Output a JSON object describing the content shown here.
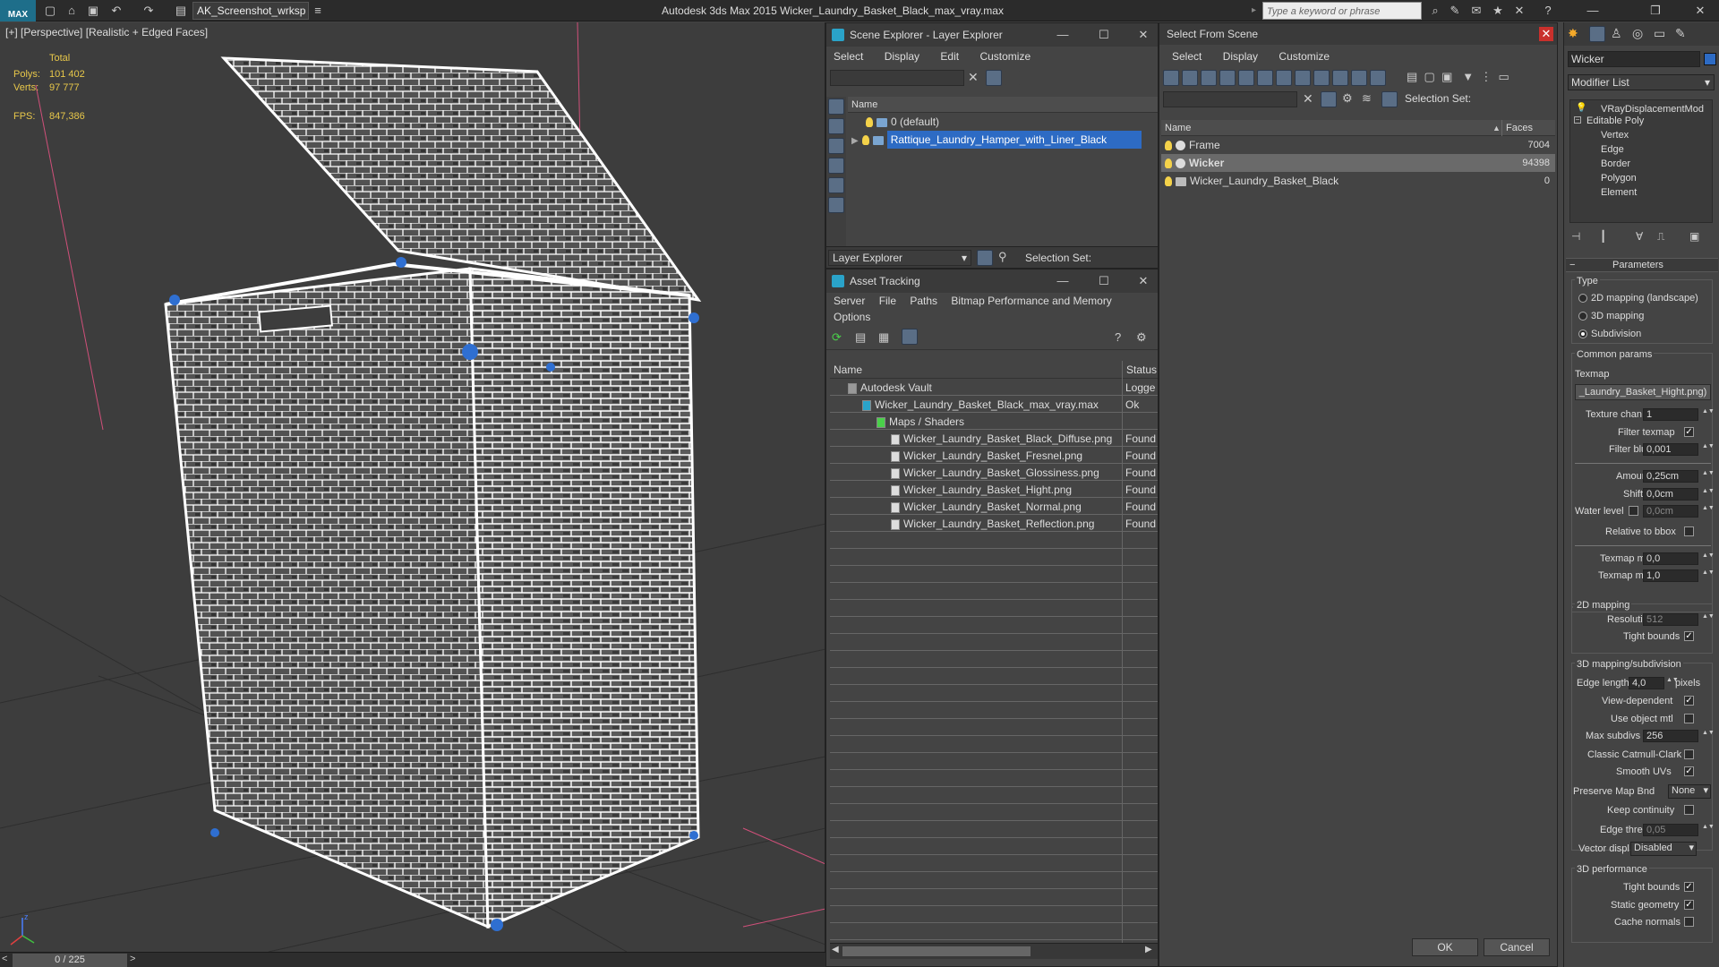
{
  "titlebar": {
    "workspace": "AK_Screenshot_wrksp",
    "title": "Autodesk 3ds Max  2015    Wicker_Laundry_Basket_Black_max_vray.max",
    "search_placeholder": "Type a keyword or phrase",
    "logo": "MAX"
  },
  "viewport": {
    "label": "[+] [Perspective] [Realistic + Edged Faces]",
    "stats": {
      "total_label": "Total",
      "polys_label": "Polys:",
      "polys_value": "101 402",
      "verts_label": "Verts:",
      "verts_value": "97 777",
      "fps_label": "FPS:",
      "fps_value": "847,386"
    },
    "time_slider": "0 / 225",
    "prev": "<",
    "next": ">"
  },
  "layer_explorer": {
    "title": "Scene Explorer - Layer Explorer",
    "menu": [
      "Select",
      "Display",
      "Edit",
      "Customize"
    ],
    "column_name": "Name",
    "rows": [
      {
        "name": "0 (default)",
        "selected": false
      },
      {
        "name": "Rattique_Laundry_Hamper_with_Liner_Black",
        "selected": true
      }
    ],
    "footer_dropdown": "Layer Explorer",
    "selection_set_label": "Selection Set:"
  },
  "asset_tracking": {
    "title": "Asset Tracking",
    "menu": [
      "Server",
      "File",
      "Paths",
      "Bitmap Performance and Memory"
    ],
    "menu2": "Options",
    "col_name": "Name",
    "col_status": "Status",
    "rows": [
      {
        "name": "Autodesk Vault",
        "status": "Logge",
        "indent": 0
      },
      {
        "name": "Wicker_Laundry_Basket_Black_max_vray.max",
        "status": "Ok",
        "indent": 1
      },
      {
        "name": "Maps / Shaders",
        "status": "",
        "indent": 2
      },
      {
        "name": "Wicker_Laundry_Basket_Black_Diffuse.png",
        "status": "Found",
        "indent": 3
      },
      {
        "name": "Wicker_Laundry_Basket_Fresnel.png",
        "status": "Found",
        "indent": 3
      },
      {
        "name": "Wicker_Laundry_Basket_Glossiness.png",
        "status": "Found",
        "indent": 3
      },
      {
        "name": "Wicker_Laundry_Basket_Hight.png",
        "status": "Found",
        "indent": 3
      },
      {
        "name": "Wicker_Laundry_Basket_Normal.png",
        "status": "Found",
        "indent": 3
      },
      {
        "name": "Wicker_Laundry_Basket_Reflection.png",
        "status": "Found",
        "indent": 3
      }
    ]
  },
  "select_from_scene": {
    "title": "Select From Scene",
    "menu": [
      "Select",
      "Display",
      "Customize"
    ],
    "selection_set_label": "Selection Set:",
    "col_name": "Name",
    "col_faces": "Faces",
    "rows": [
      {
        "name": "Frame",
        "faces": "7004",
        "selected": false
      },
      {
        "name": "Wicker",
        "faces": "94398",
        "selected": true
      },
      {
        "name": "Wicker_Laundry_Basket_Black",
        "faces": "0",
        "selected": false
      }
    ],
    "ok": "OK",
    "cancel": "Cancel"
  },
  "command_panel": {
    "object_name": "Wicker",
    "modifier_list": "Modifier List",
    "stack": [
      "VRayDisplacementMod",
      "Editable Poly",
      "Vertex",
      "Edge",
      "Border",
      "Polygon",
      "Element"
    ],
    "parameters": "Parameters",
    "type_label": "Type",
    "type_options": [
      {
        "label": "2D mapping (landscape)",
        "on": false
      },
      {
        "label": "3D mapping",
        "on": false
      },
      {
        "label": "Subdivision",
        "on": true
      }
    ],
    "common_params": "Common params",
    "texmap_label": "Texmap",
    "texmap_value": "_Laundry_Basket_Hight.png)",
    "texture_chan_label": "Texture chan",
    "texture_chan_value": "1",
    "filter_texmap_label": "Filter texmap",
    "filter_blur_label": "Filter blur",
    "filter_blur_value": "0,001",
    "amount_label": "Amount",
    "amount_value": "0,25cm",
    "shift_label": "Shift",
    "shift_value": "0,0cm",
    "water_level_label": "Water level",
    "water_level_value": "0,0cm",
    "relative_bbox_label": "Relative to bbox",
    "texmap_min_label": "Texmap min",
    "texmap_min_value": "0,0",
    "texmap_max_label": "Texmap max",
    "texmap_max_value": "1,0",
    "mapping2d": "2D mapping",
    "resolution_label": "Resolution",
    "resolution_value": "512",
    "tight_bounds_label": "Tight bounds",
    "mapping3d": "3D mapping/subdivision",
    "edge_length_label": "Edge length",
    "edge_length_value": "4,0",
    "pixels_label": "pixels",
    "view_dependent_label": "View-dependent",
    "use_object_mtl_label": "Use object mtl",
    "max_subdivs_label": "Max subdivs",
    "max_subdivs_value": "256",
    "classic_cc_label": "Classic Catmull-Clark",
    "smooth_uvs_label": "Smooth UVs",
    "preserve_map_label": "Preserve Map Bnd",
    "preserve_map_value": "None",
    "keep_continuity_label": "Keep continuity",
    "edge_thresh_label": "Edge thresh",
    "edge_thresh_value": "0,05",
    "vector_displ_label": "Vector displ",
    "vector_displ_value": "Disabled",
    "perf3d": "3D performance",
    "tight_bounds2_label": "Tight bounds",
    "static_geometry_label": "Static geometry",
    "cache_normals_label": "Cache normals"
  }
}
